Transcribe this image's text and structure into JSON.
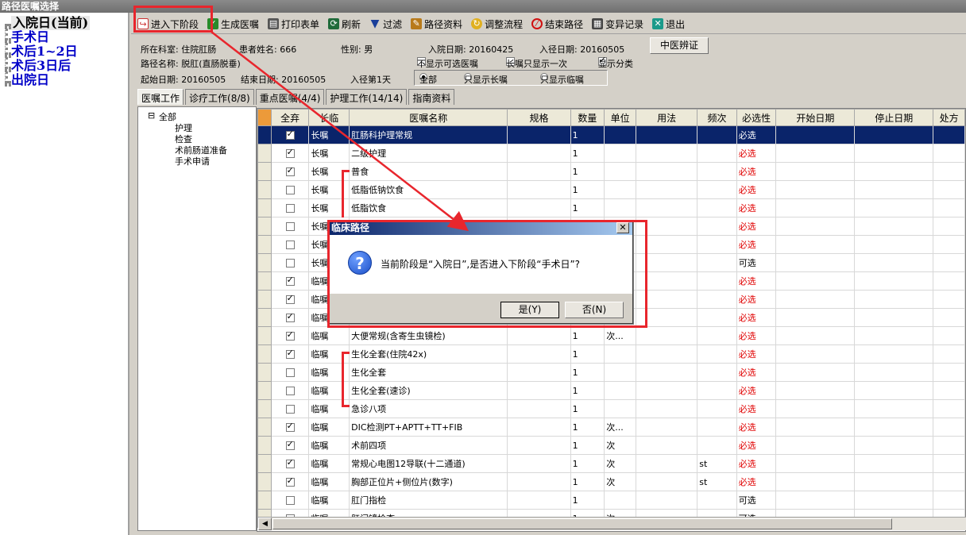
{
  "window_title": "路径医嘱选择",
  "stages": [
    "入院日(当前)",
    "手术日",
    "术后1~2日",
    "术后3日后",
    "出院日"
  ],
  "toolbar": [
    "进入下阶段",
    "生成医嘱",
    "打印表单",
    "刷新",
    "过滤",
    "路径资料",
    "调整流程",
    "结束路径",
    "变异记录",
    "退出"
  ],
  "info": {
    "dept": "所在科室: 住院肛肠",
    "patient": "患者姓名: 666",
    "gender": "性别: 男",
    "admit_date": "入院日期: 20160425",
    "path_date": "入径日期: 20160505",
    "tcm_button": "中医辨证",
    "path_name": "路径名称: 脱肛(直肠脱垂)",
    "start_date": "起始日期: 20160505",
    "end_date": "结束日期: 20160505",
    "day": "入径第1天",
    "hide_optional": "不显示可选医嘱",
    "long_once": "长嘱只显示一次",
    "show_category": "显示分类",
    "radio_all": "全部",
    "radio_long": "只显示长嘱",
    "radio_temp": "只显示临嘱"
  },
  "tabs": [
    "医嘱工作",
    "诊疗工作(8/8)",
    "重点医嘱(4/4)",
    "护理工作(14/14)",
    "指南资料"
  ],
  "tree": [
    "全部",
    "护理",
    "检查",
    "术前肠道准备",
    "手术申请"
  ],
  "columns": [
    "全弃",
    "长临",
    "医嘱名称",
    "规格",
    "数量",
    "单位",
    "用法",
    "频次",
    "必选性",
    "开始日期",
    "停止日期",
    "处方"
  ],
  "rows": [
    {
      "checked": true,
      "type": "长嘱",
      "name": "肛肠科护理常规",
      "qty": "1",
      "unit": "",
      "freq": "",
      "req": "必选"
    },
    {
      "checked": true,
      "type": "长嘱",
      "name": "二级护理",
      "qty": "1",
      "unit": "",
      "freq": "",
      "req": "必选"
    },
    {
      "checked": true,
      "type": "长嘱",
      "name": "普食",
      "qty": "1",
      "unit": "",
      "freq": "",
      "req": "必选"
    },
    {
      "checked": false,
      "type": "长嘱",
      "name": "低脂低钠饮食",
      "qty": "1",
      "unit": "",
      "freq": "",
      "req": "必选"
    },
    {
      "checked": false,
      "type": "长嘱",
      "name": "低脂饮食",
      "qty": "1",
      "unit": "",
      "freq": "",
      "req": "必选"
    },
    {
      "checked": false,
      "type": "长嘱",
      "name": "",
      "qty": "",
      "unit": "",
      "freq": "",
      "req": "必选"
    },
    {
      "checked": false,
      "type": "长嘱",
      "name": "",
      "qty": "",
      "unit": "",
      "freq": "",
      "req": "必选"
    },
    {
      "checked": false,
      "type": "长嘱",
      "name": "",
      "qty": "",
      "unit": "",
      "freq": "",
      "req": "可选"
    },
    {
      "checked": true,
      "type": "临嘱",
      "name": "",
      "qty": "",
      "unit": "",
      "freq": "",
      "req": "必选"
    },
    {
      "checked": true,
      "type": "临嘱",
      "name": "",
      "qty": "",
      "unit": "",
      "freq": "",
      "req": "必选"
    },
    {
      "checked": true,
      "type": "临嘱",
      "name": "",
      "qty": "",
      "unit": "",
      "freq": "",
      "req": "必选"
    },
    {
      "checked": true,
      "type": "临嘱",
      "name": "大便常规(含寄生虫镜检)",
      "qty": "1",
      "unit": "次...",
      "freq": "",
      "req": "必选"
    },
    {
      "checked": true,
      "type": "临嘱",
      "name": "生化全套(住院42x)",
      "qty": "1",
      "unit": "",
      "freq": "",
      "req": "必选"
    },
    {
      "checked": false,
      "type": "临嘱",
      "name": "生化全套",
      "qty": "1",
      "unit": "",
      "freq": "",
      "req": "必选"
    },
    {
      "checked": false,
      "type": "临嘱",
      "name": "生化全套(速诊)",
      "qty": "1",
      "unit": "",
      "freq": "",
      "req": "必选"
    },
    {
      "checked": false,
      "type": "临嘱",
      "name": "急诊八项",
      "qty": "1",
      "unit": "",
      "freq": "",
      "req": "必选"
    },
    {
      "checked": true,
      "type": "临嘱",
      "name": "DIC检测PT+APTT+TT+FIB",
      "qty": "1",
      "unit": "次...",
      "freq": "",
      "req": "必选"
    },
    {
      "checked": true,
      "type": "临嘱",
      "name": "术前四项",
      "qty": "1",
      "unit": "次",
      "freq": "",
      "req": "必选"
    },
    {
      "checked": true,
      "type": "临嘱",
      "name": "常规心电图12导联(十二通道)",
      "qty": "1",
      "unit": "次",
      "freq": "st",
      "req": "必选"
    },
    {
      "checked": true,
      "type": "临嘱",
      "name": "胸部正位片+侧位片(数字)",
      "qty": "1",
      "unit": "次",
      "freq": "st",
      "req": "必选"
    },
    {
      "checked": false,
      "type": "临嘱",
      "name": "肛门指检",
      "qty": "1",
      "unit": "",
      "freq": "",
      "req": "可选"
    },
    {
      "checked": false,
      "type": "临嘱",
      "name": "肛门镜检查",
      "qty": "1",
      "unit": "次",
      "freq": "",
      "req": "可选"
    }
  ],
  "dialog": {
    "title": "临床路径",
    "message": "当前阶段是“入院日”,是否进入下阶段“手术日”?",
    "yes": "是(Y)",
    "no": "否(N)"
  },
  "colors": {
    "highlight": "#e8262d",
    "selection": "#0a246a",
    "required": "#e00000"
  }
}
